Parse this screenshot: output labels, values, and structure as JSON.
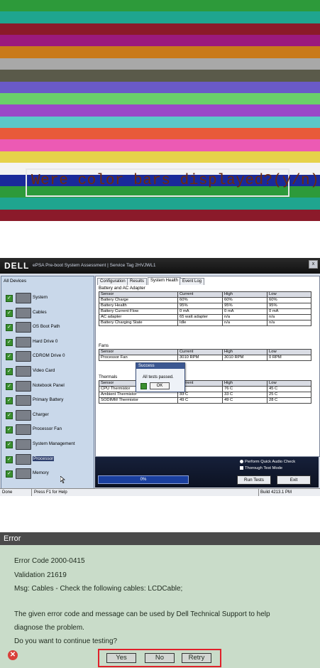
{
  "color_bars": {
    "prompt": "Were color bars displayed?(y/n)",
    "colors": [
      "#2d9a3a",
      "#1fa58f",
      "#8b1a2a",
      "#9b1a7d",
      "#c97a1a",
      "#a8a8a8",
      "#5a5a4a",
      "#6a5ac8",
      "#6acf6a",
      "#9a48c8",
      "#5ac8c8",
      "#e85a3a",
      "#ec5ab4",
      "#e6d24a",
      "#f3f3f3",
      "#1a2a9a",
      "#2d9a3a",
      "#1fa58f",
      "#8b1a2a"
    ]
  },
  "epsa": {
    "logo": "DELL",
    "window_title": "ePSA Pre-boot System Assessment  |  Service Tag 2HVJWL1",
    "close": "x",
    "left_header": "All Devices",
    "devices": [
      {
        "label": "System"
      },
      {
        "label": "Cables"
      },
      {
        "label": "OS Boot Path"
      },
      {
        "label": "Hard Drive 0"
      },
      {
        "label": "CDROM Drive 0"
      },
      {
        "label": "Video Card"
      },
      {
        "label": "Notebook Panel"
      },
      {
        "label": "Primary Battery"
      },
      {
        "label": "Charger"
      },
      {
        "label": "Processor Fan"
      },
      {
        "label": "System Management"
      },
      {
        "label": "Processor"
      },
      {
        "label": "Memory"
      }
    ],
    "tabs": [
      "Configuration",
      "Results",
      "System Health",
      "Event Log"
    ],
    "active_tab": "System Health",
    "battery": {
      "title": "Battery and AC Adapter",
      "columns": [
        "Sensor",
        "Current",
        "High",
        "Low"
      ],
      "rows": [
        [
          "Battery Charge",
          "60%",
          "60%",
          "60%"
        ],
        [
          "Battery Health",
          "95%",
          "95%",
          "95%"
        ],
        [
          "Battery Current Flow",
          "0 mA",
          "0 mA",
          "0 mA"
        ],
        [
          "AC adapter",
          "65 watt adapter",
          "n/a",
          "n/a"
        ],
        [
          "Battery Charging State",
          "Idle",
          "n/a",
          "n/a"
        ]
      ]
    },
    "fans": {
      "title": "Fans",
      "columns": [
        "Sensor",
        "Current",
        "High",
        "Low"
      ],
      "rows": [
        [
          "Processor Fan",
          "3010 RPM",
          "3010 RPM",
          "0 RPM"
        ]
      ]
    },
    "thermals": {
      "title": "Thermals",
      "columns": [
        "Sensor",
        "Current",
        "High",
        "Low"
      ],
      "rows": [
        [
          "CPU Thermistor",
          "C",
          "76 C",
          "45 C"
        ],
        [
          "Ambient Thermistor",
          "33 C",
          "33 C",
          "25 C"
        ],
        [
          "SODIMM Thermistor",
          "49 C",
          "49 C",
          "28 C"
        ]
      ]
    },
    "dialog": {
      "title": "Success",
      "message": "All tests passed.",
      "ok": "OK"
    },
    "options": {
      "quick_audio": "Perform Quick Audio Check",
      "thorough": "Thorough Test Mode"
    },
    "progress": "0%",
    "run_tests": "Run Tests",
    "exit": "Exit",
    "status": {
      "left": "Done",
      "help": "Press F1 for Help",
      "build": "Build 4213.1  PM"
    }
  },
  "error": {
    "title": "Error",
    "code": "Error Code 2000-0415",
    "validation": "Validation 21619",
    "msg": "Msg: Cables - Check the following cables: LCDCable;",
    "info1": "The given error code and message can be used by Dell Technical Support to help",
    "info2": "diagnose the problem.",
    "question": "Do you want to continue testing?",
    "yes": "Yes",
    "no": "No",
    "retry": "Retry"
  }
}
